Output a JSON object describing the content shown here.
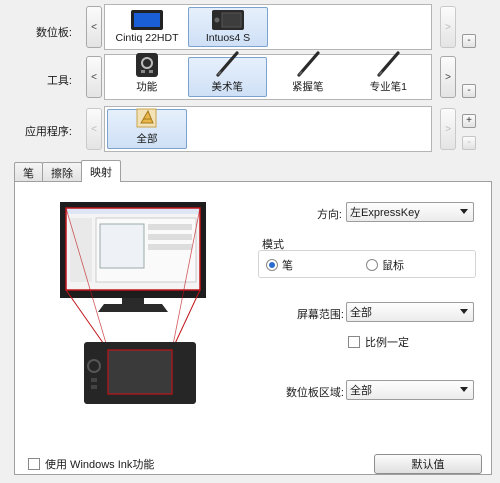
{
  "rows": {
    "tablet": {
      "label": "数位板:",
      "tiles": [
        {
          "label": "Cintiq 22HDT",
          "icon": "cintiq-display-icon",
          "selected": false
        },
        {
          "label": "Intuos4 S",
          "icon": "intuos-tablet-icon",
          "selected": true
        }
      ],
      "prev": "<",
      "next": ">",
      "remove": "-"
    },
    "tool": {
      "label": "工具:",
      "tiles": [
        {
          "label": "功能",
          "icon": "express-keys-icon",
          "selected": false
        },
        {
          "label": "美术笔",
          "icon": "art-pen-icon",
          "selected": true
        },
        {
          "label": "紧握笔",
          "icon": "grip-pen-icon",
          "selected": false
        },
        {
          "label": "专业笔1",
          "icon": "pro-pen-icon",
          "selected": false
        }
      ],
      "prev": "<",
      "next": ">",
      "remove": "-"
    },
    "app": {
      "label": "应用程序:",
      "tiles": [
        {
          "label": "全部",
          "icon": "all-apps-icon",
          "selected": true
        }
      ],
      "prev": "<",
      "next": ">",
      "add": "+",
      "remove": "-"
    }
  },
  "tabs": [
    "笔",
    "擦除",
    "映射"
  ],
  "active_tab": "映射",
  "mapping": {
    "orientation_label": "方向:",
    "orientation_value": "左ExpressKey",
    "mode_group_label": "模式",
    "mode_pen": "笔",
    "mode_mouse": "鼠标",
    "mode_selected": "pen",
    "screen_area_label": "屏幕范围:",
    "screen_area_value": "全部",
    "proportional_label": "比例一定",
    "tablet_area_label": "数位板区域:",
    "tablet_area_value": "全部"
  },
  "footer": {
    "windows_ink_label": "使用 Windows Ink功能",
    "default_button": "默认值"
  },
  "colors": {
    "selection": "#cfe0f6",
    "mapping_lines": "#c0141a",
    "radio_accent": "#2a6bd1"
  }
}
